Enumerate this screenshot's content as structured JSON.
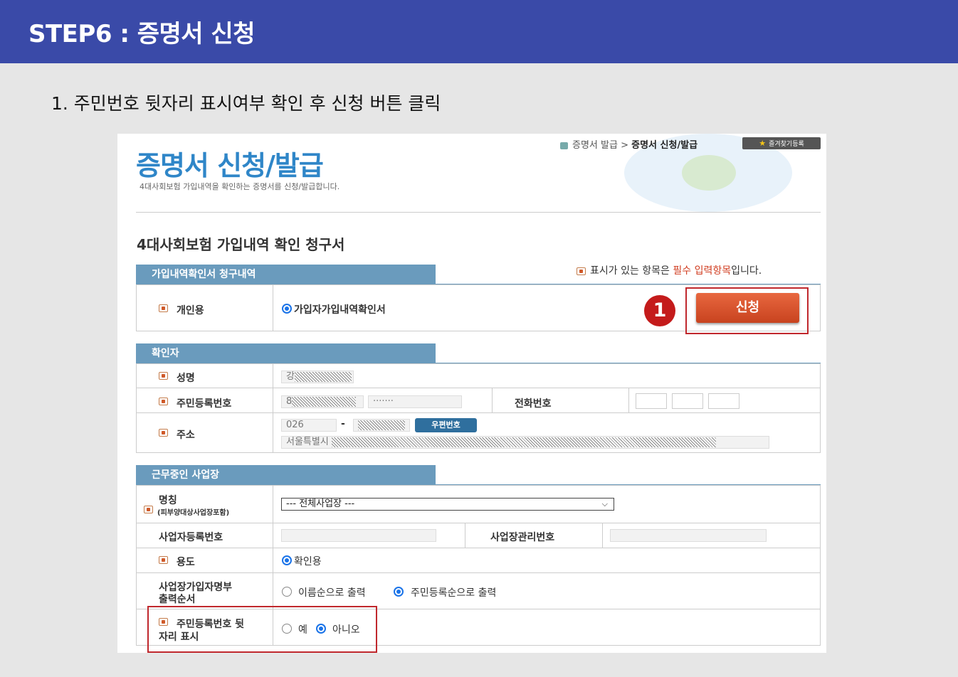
{
  "header": {
    "title": "STEP6 : 증명서 신청"
  },
  "instruction": "1. 주민번호 뒷자리 표시여부 확인 후 신청 버튼 클릭",
  "marker": "1",
  "screenshot": {
    "breadcrumb": {
      "home": "증명서 발급",
      "sep": ">",
      "current": "증명서 신청/발급"
    },
    "bookmark": "즐겨찾기등록",
    "page_title": "증명서 신청/발급",
    "page_subtitle": "4대사회보험 가입내역을 확인하는 증명서를 신청/발급합니다.",
    "form_title": "4대사회보험 가입내역 확인 청구서",
    "required_note": {
      "prefix": "표시가 있는 항목은 ",
      "highlight": "필수 입력항목",
      "suffix": "입니다."
    },
    "section1": {
      "tab": "가입내역확인서 청구내역",
      "row_label": "개인용",
      "option": "가입자가입내역확인서",
      "apply_button": "신청"
    },
    "section2": {
      "tab": "확인자",
      "name_label": "성명",
      "name_value": "강",
      "rrn_label": "주민등록번호",
      "rrn_front": "8",
      "rrn_back": "·······",
      "phone_label": "전화번호",
      "address_label": "주소",
      "zip_front": "026",
      "zip_dash": "-",
      "zip_button": "우편번호",
      "address_value": "서울특별시"
    },
    "section3": {
      "tab": "근무중인 사업장",
      "title_label": "명칭",
      "title_sub": "(피부양대상사업장포함)",
      "workplace_select": "--- 전체사업장 ---",
      "biz_reg_label": "사업자등록번호",
      "biz_mgmt_label": "사업장관리번호",
      "usage_label": "용도",
      "usage_option": "확인용",
      "order_label_1": "사업장가입자명부",
      "order_label_2": "출력순서",
      "order_option_name": "이름순으로 출력",
      "order_option_rrn": "주민등록순으로 출력",
      "show_rrn_label_1": "주민등록번호 뒷",
      "show_rrn_label_2": "자리 표시",
      "show_yes": "예",
      "show_no": "아니오"
    }
  }
}
